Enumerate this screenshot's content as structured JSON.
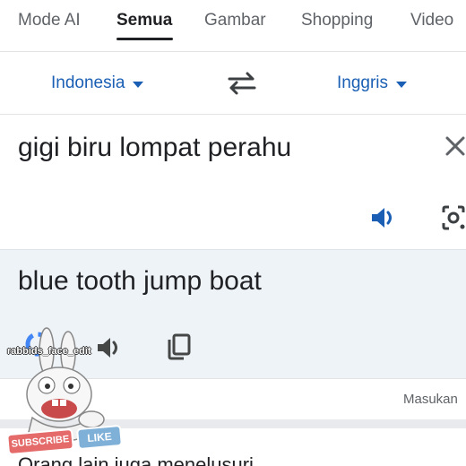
{
  "tabs": [
    {
      "label": "Mode AI"
    },
    {
      "label": "Semua",
      "active": true
    },
    {
      "label": "Gambar"
    },
    {
      "label": "Shopping"
    },
    {
      "label": "Video"
    }
  ],
  "translator": {
    "source_language": "Indonesia",
    "target_language": "Inggris",
    "source_text": "gigi biru lompat perahu",
    "translated_text": "blue tooth jump boat",
    "feedback_label": "Masukan"
  },
  "related": {
    "title": "Orang lain juga menelusuri"
  },
  "watermark": {
    "handle": "rabbids_face_edit",
    "subscribe_label": "SUBSCRIBE",
    "like_label": "LIKE"
  },
  "colors": {
    "accent_blue": "#1a5fb4",
    "target_panel_bg": "#eef3f8",
    "text_primary": "#202124",
    "text_secondary": "#5f6368"
  },
  "icons": [
    "swap-languages-icon",
    "clear-icon",
    "speaker-icon",
    "google-lens-icon",
    "copy-icon",
    "caret-down-icon"
  ]
}
